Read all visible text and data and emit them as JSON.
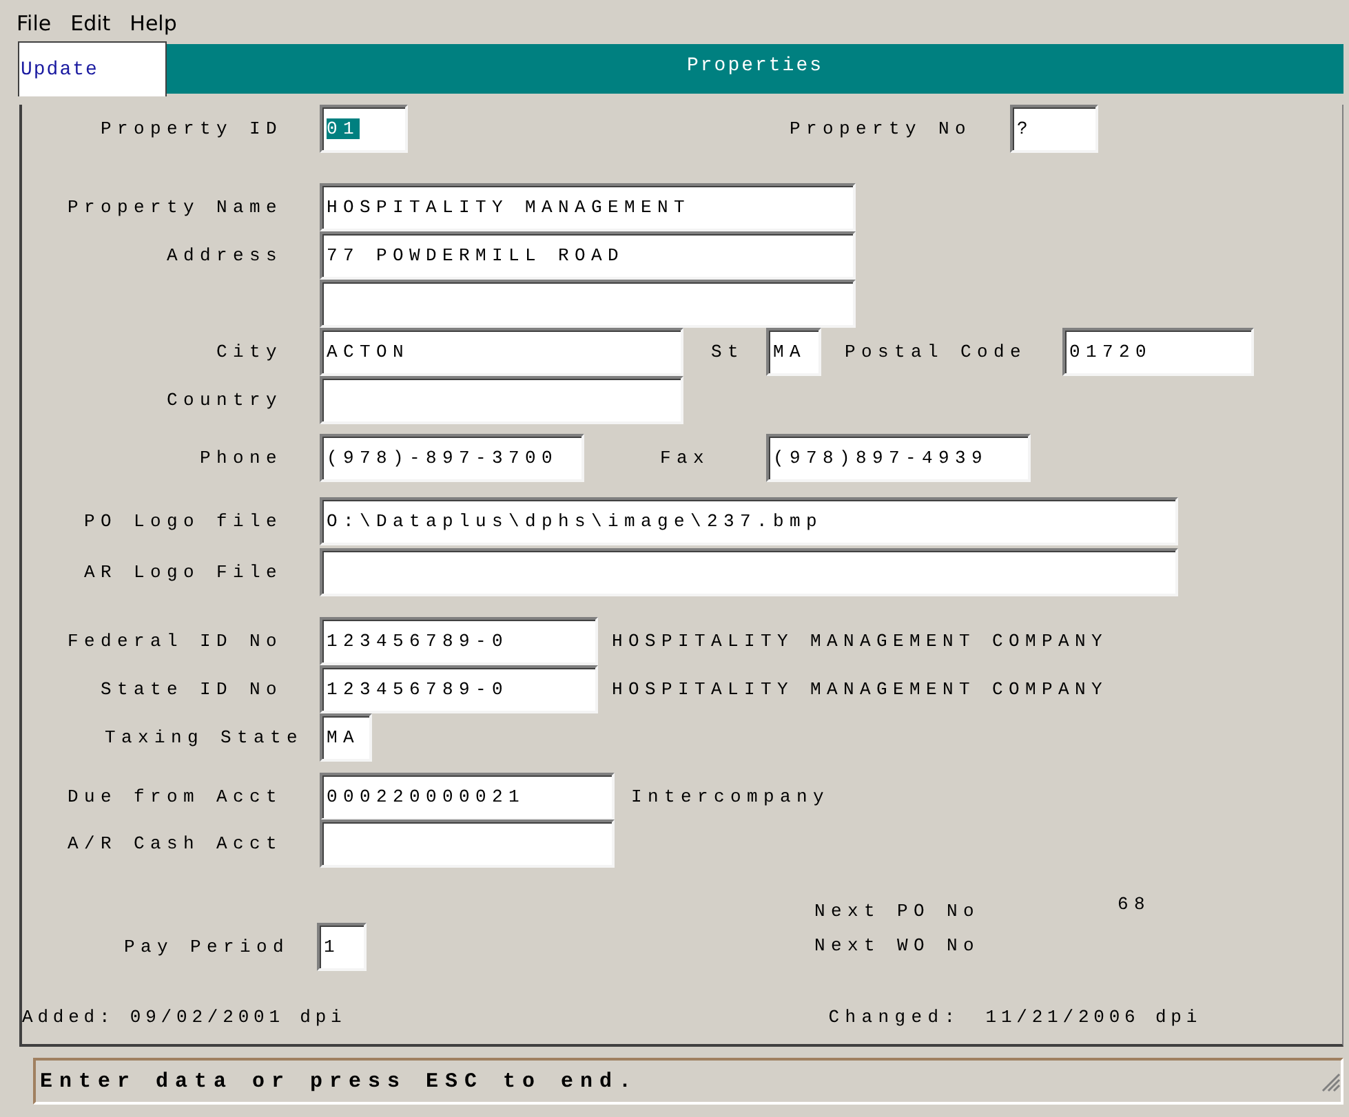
{
  "menu": [
    "File",
    "Edit",
    "Help"
  ],
  "mode": "Update",
  "window": {
    "title": "Properties"
  },
  "rows": [
    {
      "items": [
        {
          "kind": "label",
          "text": "Property ID"
        },
        {
          "kind": "field",
          "value": "01",
          "selected": true
        },
        {
          "kind": "label",
          "text": "Property No"
        },
        {
          "kind": "field",
          "value": "?",
          "selected": false
        }
      ]
    },
    {
      "items": [
        {
          "kind": "label",
          "text": "Property Name"
        },
        {
          "kind": "field",
          "value": "HOSPITALITY MANAGEMENT",
          "selected": false
        }
      ]
    },
    {
      "items": [
        {
          "kind": "label",
          "text": "Address"
        },
        {
          "kind": "field",
          "value": "77 POWDERMILL ROAD",
          "selected": false
        }
      ]
    },
    {
      "items": [
        {
          "kind": "field",
          "value": "",
          "selected": false
        }
      ]
    },
    {
      "items": [
        {
          "kind": "label",
          "text": "City"
        },
        {
          "kind": "field",
          "value": "ACTON",
          "selected": false
        },
        {
          "kind": "label",
          "text": "St"
        },
        {
          "kind": "field",
          "value": "MA",
          "selected": false
        },
        {
          "kind": "label",
          "text": "Postal Code"
        },
        {
          "kind": "field",
          "value": "01720",
          "selected": false
        }
      ]
    },
    {
      "items": [
        {
          "kind": "label",
          "text": "Country"
        },
        {
          "kind": "field",
          "value": "",
          "selected": false
        }
      ]
    },
    {
      "items": [
        {
          "kind": "label",
          "text": "Phone"
        },
        {
          "kind": "field",
          "value": "(978)-897-3700",
          "selected": false
        },
        {
          "kind": "label",
          "text": "Fax"
        },
        {
          "kind": "field",
          "value": "(978)897-4939",
          "selected": false
        }
      ]
    },
    {
      "items": [
        {
          "kind": "label",
          "text": "PO Logo file"
        },
        {
          "kind": "field",
          "value": "O:\\Dataplus\\dphs\\image\\237.bmp",
          "selected": false
        }
      ]
    },
    {
      "items": [
        {
          "kind": "label",
          "text": "AR Logo File"
        },
        {
          "kind": "field",
          "value": "",
          "selected": false
        }
      ]
    },
    {
      "items": [
        {
          "kind": "label",
          "text": "Federal ID No"
        },
        {
          "kind": "field",
          "value": "123456789-0",
          "selected": false
        },
        {
          "kind": "text",
          "text": "HOSPITALITY MANAGEMENT COMPANY"
        }
      ]
    },
    {
      "items": [
        {
          "kind": "label",
          "text": "State ID No"
        },
        {
          "kind": "field",
          "value": "123456789-0",
          "selected": false
        },
        {
          "kind": "text",
          "text": "HOSPITALITY MANAGEMENT COMPANY"
        }
      ]
    },
    {
      "items": [
        {
          "kind": "label",
          "text": "Taxing State"
        },
        {
          "kind": "field",
          "value": "MA",
          "selected": false
        }
      ]
    },
    {
      "items": [
        {
          "kind": "label",
          "text": "Due from Acct"
        },
        {
          "kind": "field",
          "value": "000220000021",
          "selected": false
        },
        {
          "kind": "text",
          "text": "Intercompany"
        }
      ]
    },
    {
      "items": [
        {
          "kind": "label",
          "text": "A/R Cash Acct"
        },
        {
          "kind": "field",
          "value": "",
          "selected": false
        }
      ]
    }
  ],
  "pay_period": {
    "label": "Pay Period",
    "value": "1",
    "selected": false
  },
  "next_numbers": [
    {
      "label": "Next PO No",
      "value": "68"
    },
    {
      "label": "Next WO No"
    }
  ],
  "footer": {
    "added": "Added: 09/02/2001 dpi",
    "changed_label": "Changed:",
    "changed": "11/21/2006 dpi"
  },
  "status_bar": "Enter data or press ESC to end."
}
